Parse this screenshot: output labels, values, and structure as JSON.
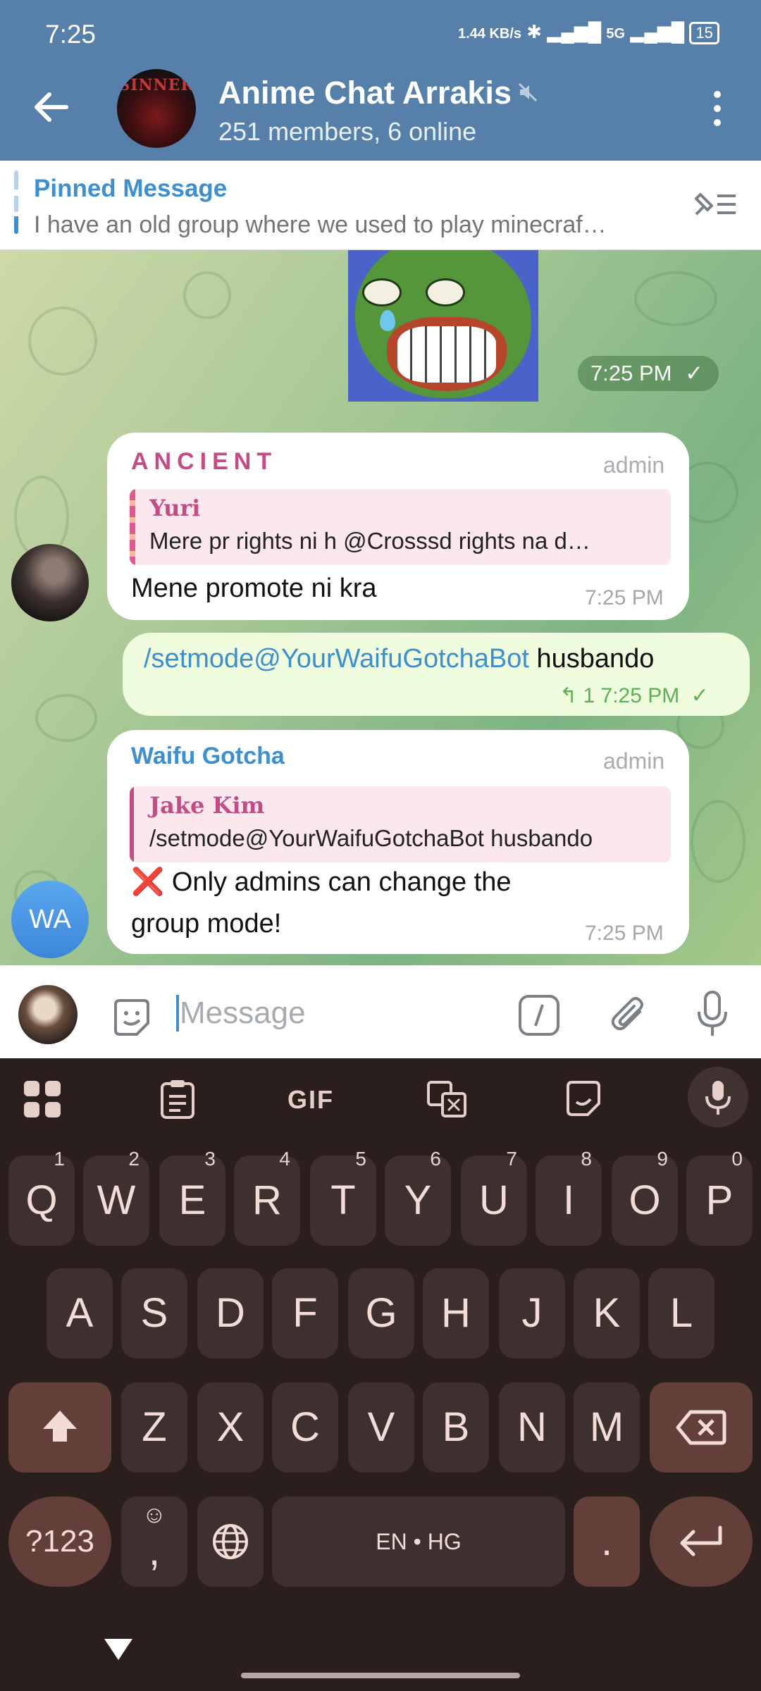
{
  "status": {
    "time": "7:25",
    "net_speed": "1.44 KB/s",
    "network": "5G",
    "battery": "15"
  },
  "header": {
    "title": "Anime Chat Arrakis",
    "subtitle": "251 members, 6 online",
    "avatar_text": "SINNER"
  },
  "pinned": {
    "title": "Pinned Message",
    "text": "I have an old group where we used to play minecraf…"
  },
  "messages": {
    "sticker_time": "7:25 PM",
    "m1": {
      "sender": "ANCIENT",
      "tag": "admin",
      "reply_name": "Yuri",
      "reply_text": "Mere pr rights ni h @Crosssd rights na d…",
      "text": "Mene promote ni kra",
      "time": "7:25 PM"
    },
    "m2": {
      "command": "/setmode@YourWaifuGotchaBot",
      "arg": " husbando",
      "replies": "1",
      "time": "7:25 PM"
    },
    "m3": {
      "sender": "Waifu Gotcha",
      "tag": "admin",
      "reply_name": "Jake Kim",
      "reply_text": "/setmode@YourWaifuGotchaBot husbando",
      "text_line1": "❌ Only admins can change the",
      "text_line2": "group mode!",
      "time": "7:25 PM",
      "avatar": "WA"
    }
  },
  "input": {
    "placeholder": "Message"
  },
  "keyboard": {
    "toolbar_gif": "GIF",
    "row1": [
      "Q",
      "W",
      "E",
      "R",
      "T",
      "Y",
      "U",
      "I",
      "O",
      "P"
    ],
    "row1_hints": [
      "1",
      "2",
      "3",
      "4",
      "5",
      "6",
      "7",
      "8",
      "9",
      "0"
    ],
    "row2": [
      "A",
      "S",
      "D",
      "F",
      "G",
      "H",
      "J",
      "K",
      "L"
    ],
    "row3": [
      "Z",
      "X",
      "C",
      "V",
      "B",
      "N",
      "M"
    ],
    "sym": "?123",
    "comma": ",",
    "emoji": "☺",
    "space": "EN • HG",
    "dot": "."
  },
  "colors": {
    "header": "#5680a9",
    "accent": "#3d8fd0",
    "outgoing_bubble": "#effdde",
    "sender_ancient": "#c54b86",
    "keyboard_bg": "#2b1f1d"
  }
}
